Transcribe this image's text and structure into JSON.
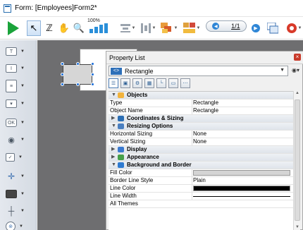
{
  "window": {
    "title": "Form: [Employees]Form2*"
  },
  "toolbar": {
    "zoom_label": "100%",
    "page_indicator": "1/1",
    "buttons": [
      {
        "icon": "play-icon"
      },
      {
        "icon": "pointer-icon"
      },
      {
        "icon": "entry-order-icon"
      },
      {
        "icon": "hand-icon"
      },
      {
        "icon": "zoom-icon"
      },
      {
        "icon": "bar-chart-icon"
      },
      {
        "icon": "align-icon"
      },
      {
        "icon": "distribute-icon"
      },
      {
        "icon": "layers-icon"
      },
      {
        "icon": "group-icon"
      },
      {
        "icon": "page-prev-icon"
      },
      {
        "icon": "page-next-icon"
      },
      {
        "icon": "view-icon"
      },
      {
        "icon": "settings-icon"
      }
    ]
  },
  "palette": {
    "tools": [
      {
        "icon": "field-tool-icon"
      },
      {
        "icon": "text-tool-icon"
      },
      {
        "icon": "list-tool-icon"
      },
      {
        "icon": "popup-tool-icon"
      },
      {
        "icon": "button-tool-icon"
      },
      {
        "icon": "radio-tool-icon"
      },
      {
        "icon": "checkbox-tool-icon"
      },
      {
        "icon": "splitter-tool-icon"
      },
      {
        "icon": "rectangle-tool-icon"
      },
      {
        "icon": "line-tool-icon"
      },
      {
        "icon": "plugin-tool-icon"
      }
    ]
  },
  "property_list": {
    "title": "Property List",
    "selected_object": "Rectangle",
    "rows": [
      {
        "type": "section",
        "label": "Objects",
        "expanded": true,
        "icon": "objects-icon"
      },
      {
        "type": "prop",
        "key": "Type",
        "value": "Rectangle"
      },
      {
        "type": "prop",
        "key": "Object Name",
        "value": "Rectangle"
      },
      {
        "type": "section",
        "label": "Coordinates & Sizing",
        "expanded": false,
        "icon": "coordinates-icon"
      },
      {
        "type": "section",
        "label": "Resizing Options",
        "expanded": true,
        "icon": "resizing-icon"
      },
      {
        "type": "prop",
        "key": "Horizontal Sizing",
        "value": "None"
      },
      {
        "type": "prop",
        "key": "Vertical Sizing",
        "value": "None"
      },
      {
        "type": "section",
        "label": "Display",
        "expanded": false,
        "icon": "display-icon"
      },
      {
        "type": "section",
        "label": "Appearance",
        "expanded": false,
        "icon": "appearance-icon"
      },
      {
        "type": "section",
        "label": "Background and Border",
        "expanded": true,
        "icon": "background-icon"
      },
      {
        "type": "prop",
        "key": "Fill Color",
        "value": ""
      },
      {
        "type": "prop",
        "key": "Border Line Style",
        "value": "Plain"
      },
      {
        "type": "prop",
        "key": "Line Color",
        "value": ""
      },
      {
        "type": "prop",
        "key": "Line Width",
        "value": ""
      },
      {
        "type": "prop",
        "key": "All Themes",
        "value": ""
      }
    ],
    "colors": {
      "fill": "#d4d4d4",
      "line": "#000000",
      "objects_icon": "#f2b33d",
      "coordinates_icon": "#2c6fb4",
      "resizing_icon": "#4a7fc0",
      "display_icon": "#3a7ad0",
      "appearance_icon": "#46a04a",
      "background_icon": "#2f7bd1"
    }
  }
}
